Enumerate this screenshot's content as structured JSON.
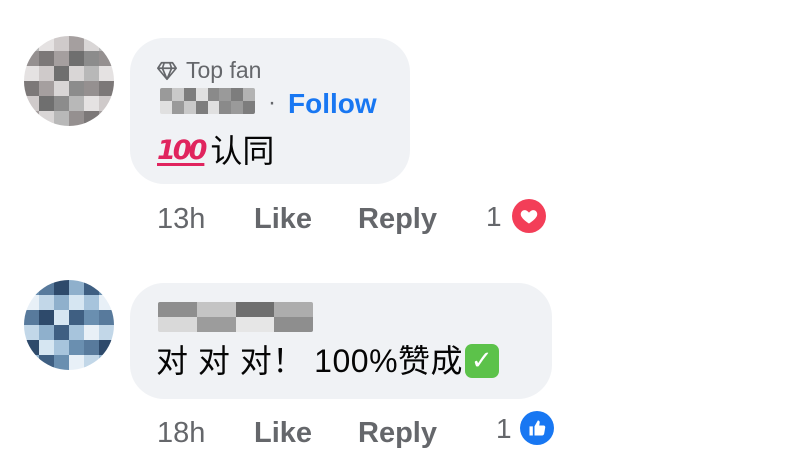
{
  "comments": [
    {
      "badge": "Top fan",
      "follow_separator": "·",
      "follow_label": "Follow",
      "emoji_label": "100",
      "text": "认同",
      "time": "13h",
      "like_label": "Like",
      "reply_label": "Reply",
      "reaction_count": "1",
      "reaction_type": "love-icon"
    },
    {
      "text": "对 对 对！ 100%赞成",
      "time": "18h",
      "like_label": "Like",
      "reply_label": "Reply",
      "reaction_count": "1",
      "reaction_type": "like-icon"
    }
  ],
  "colors": {
    "bubble": "#f0f2f5",
    "link": "#1877f2",
    "secondary_text": "#65676b",
    "love": "#f33e58",
    "like": "#1877f2",
    "check": "#5cc24a"
  }
}
